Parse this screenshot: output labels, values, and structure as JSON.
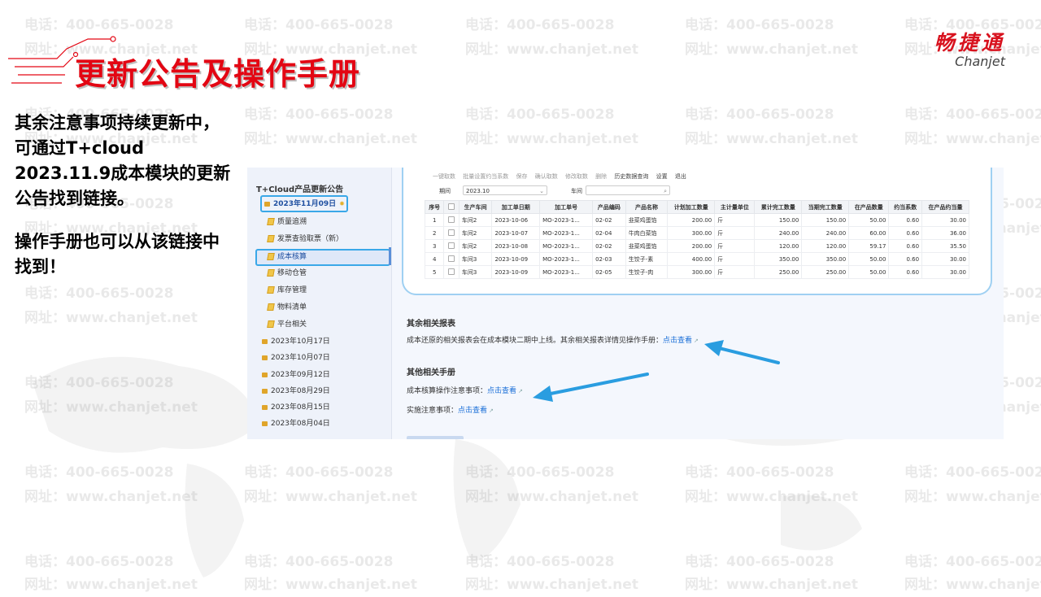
{
  "slide": {
    "title": "更新公告及操作手册",
    "paragraphs": [
      "其余注意事项持续更新中，可通过T+cloud 2023.11.9成本模块的更新公告找到链接。",
      "操作手册也可以从该链接中找到！"
    ],
    "watermark": {
      "phone": "电话：400-665-0028",
      "site": "网址：www.chanjet.net"
    }
  },
  "logo": {
    "cn": "畅捷通",
    "en": "Chanjet"
  },
  "sidebar": {
    "title": "T+Cloud产品更新公告",
    "active_date": "2023年11月09日",
    "sub_items": [
      {
        "label": "质量追溯"
      },
      {
        "label": "发票查验取票（新）"
      },
      {
        "label": "成本核算"
      },
      {
        "label": "移动仓管"
      },
      {
        "label": "库存管理"
      },
      {
        "label": "物料清单"
      },
      {
        "label": "平台相关"
      }
    ],
    "dates": [
      "2023年10月17日",
      "2023年10月07日",
      "2023年09月12日",
      "2023年08月29日",
      "2023年08月15日",
      "2023年08月04日"
    ]
  },
  "screenshot": {
    "toolbar": [
      "一键取数",
      "批量设置约当系数",
      "保存",
      "确认取数",
      "修改取数",
      "删除",
      "历史数据查询",
      "设置",
      "退出"
    ],
    "filter": {
      "period_label": "期间",
      "period_value": "2023.10",
      "workshop_label": "车间",
      "workshop_value": ""
    },
    "table": {
      "headers": [
        "序号",
        "",
        "生产车间",
        "加工单日期",
        "加工单号",
        "产品编码",
        "产品名称",
        "计划加工数量",
        "主计量单位",
        "累计完工数量",
        "当期完工数量",
        "在产品数量",
        "约当系数",
        "在产品约当量"
      ],
      "rows": [
        [
          "1",
          "",
          "车间2",
          "2023-10-06",
          "MO-2023-1...",
          "02-02",
          "韭菜鸡蛋馅",
          "200.00",
          "斤",
          "150.00",
          "150.00",
          "50.00",
          "0.60",
          "30.00"
        ],
        [
          "2",
          "",
          "车间2",
          "2023-10-07",
          "MO-2023-1...",
          "02-04",
          "牛肉白菜馅",
          "300.00",
          "斤",
          "240.00",
          "240.00",
          "60.00",
          "0.60",
          "36.00"
        ],
        [
          "3",
          "",
          "车间2",
          "2023-10-08",
          "MO-2023-1...",
          "02-02",
          "韭菜鸡蛋馅",
          "200.00",
          "斤",
          "120.00",
          "120.00",
          "59.17",
          "0.60",
          "35.50"
        ],
        [
          "4",
          "",
          "车间3",
          "2023-10-09",
          "MO-2023-1...",
          "02-03",
          "生饺子-素",
          "400.00",
          "斤",
          "350.00",
          "350.00",
          "50.00",
          "0.60",
          "30.00"
        ],
        [
          "5",
          "",
          "车间3",
          "2023-10-09",
          "MO-2023-1...",
          "02-05",
          "生饺子-肉",
          "300.00",
          "斤",
          "250.00",
          "250.00",
          "50.00",
          "0.60",
          "30.00"
        ]
      ]
    },
    "reports": {
      "title": "其余相关报表",
      "text": "成本还原的相关报表会在成本模块二期中上线。其余相关报表详情见操作手册：",
      "link": "点击查看"
    },
    "manuals": {
      "title": "其他相关手册",
      "item1_label": "成本核算操作注意事项：",
      "item1_link": "点击查看",
      "item2_label": "实施注意事项：",
      "item2_link": "点击查看"
    }
  },
  "colors": {
    "title_red": "#e30613",
    "link_blue": "#1a6fd8",
    "highlight_blue": "#3aa8e8",
    "arrow_blue": "#2a9de0"
  }
}
